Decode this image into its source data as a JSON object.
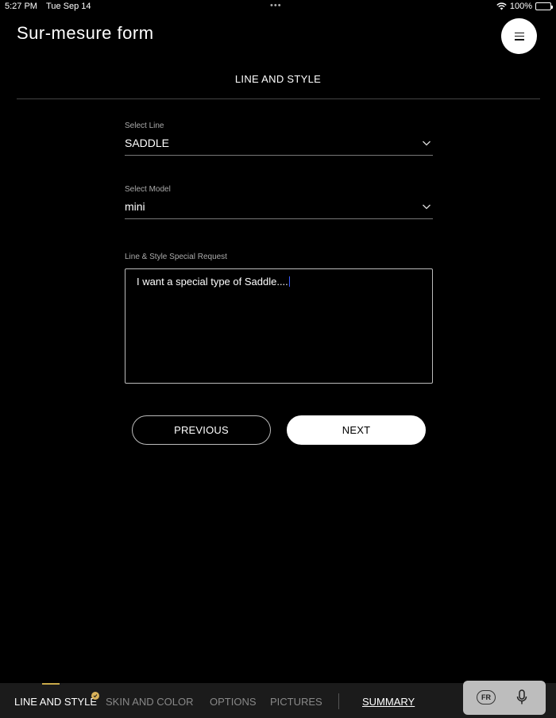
{
  "status_bar": {
    "time": "5:27 PM",
    "date": "Tue Sep 14",
    "dots": "•••",
    "battery": "100%",
    "icons": [
      "wifi-icon",
      "battery-icon"
    ]
  },
  "header": {
    "title": "Sur-mesure form",
    "menu_icon": "hamburger-icon"
  },
  "section": {
    "title": "LINE AND STYLE"
  },
  "form": {
    "line": {
      "label": "Select Line",
      "value": "SADDLE"
    },
    "model": {
      "label": "Select Model",
      "value": "mini"
    },
    "request": {
      "label": "Line & Style Special Request",
      "value": "I want a special type of Saddle...."
    }
  },
  "buttons": {
    "previous": "PREVIOUS",
    "next": "NEXT"
  },
  "bottom_nav": {
    "items": [
      {
        "label": "LINE AND STYLE",
        "active": true,
        "completed": true
      },
      {
        "label": "SKIN AND COLOR",
        "active": false
      },
      {
        "label": "OPTIONS",
        "active": false
      },
      {
        "label": "PICTURES",
        "active": false
      },
      {
        "label": "SUMMARY",
        "active": false
      }
    ],
    "language": "FR",
    "mic_icon": "microphone-icon"
  },
  "colors": {
    "background": "#000000",
    "accent_gold": "#c9a94a",
    "nav_background": "#1b1b1b",
    "caret_blue": "#3b5cff"
  }
}
